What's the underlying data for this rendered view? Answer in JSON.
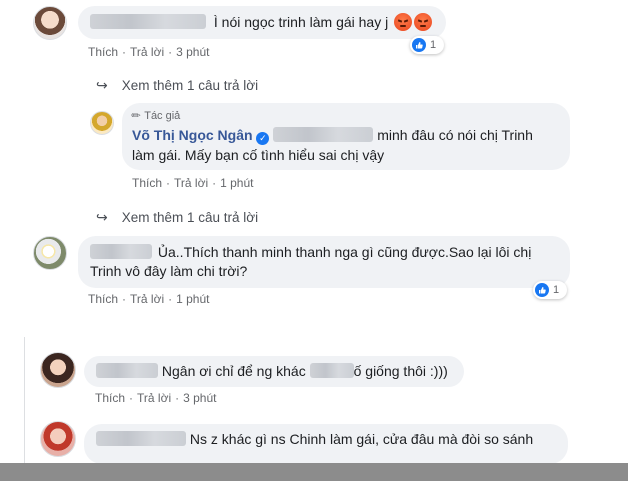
{
  "comments": [
    {
      "text": "Ì nói ngọc trinh làm gái hay j",
      "actions": [
        "Thích",
        "Trả lời",
        "3 phút"
      ],
      "reaction_count": "1"
    },
    {
      "view_more": "Xem thêm 1 câu trả lời"
    },
    {
      "author_badge": "Tác giả",
      "author": "Võ Thị Ngọc Ngân",
      "text_line1": "minh đâu có nói chị Trinh",
      "text_line2": "làm gái. Mấy bạn cố tình hiểu sai chị vậy",
      "actions": [
        "Thích",
        "Trả lời",
        "1 phút"
      ]
    },
    {
      "view_more": "Xem thêm 1 câu trả lời"
    },
    {
      "text_line1": "Ủa..Thích thanh minh thanh nga gì cũng được.Sao lại lôi chị",
      "text_line2": "Trinh vô đây làm chi trời?",
      "actions": [
        "Thích",
        "Trả lời",
        "1 phút"
      ],
      "reaction_count": "1"
    },
    {
      "text_a": "Ngân ơi chỉ để ng khác",
      "text_b": "ố giống thôi :)))",
      "actions": [
        "Thích",
        "Trả lời",
        "3 phút"
      ]
    },
    {
      "text": "Ns z khác gì ns Chinh làm gái, cửa đâu mà đòi so sánh"
    }
  ],
  "colors": {
    "bubble": "#f0f2f5",
    "name": "#385898",
    "like": "#1877f2",
    "meta": "#65676b"
  }
}
